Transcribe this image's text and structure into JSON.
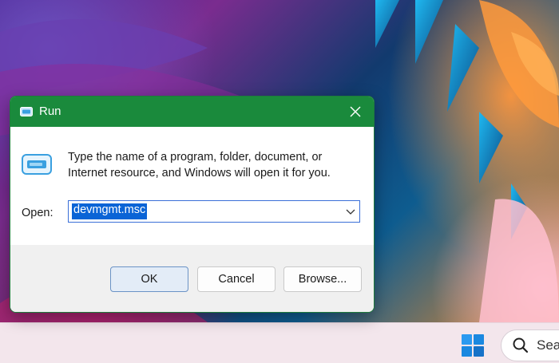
{
  "dialog": {
    "title": "Run",
    "description_line1": "Type the name of a program, folder, document, or",
    "description_line2": "Internet resource, and Windows will open it for you.",
    "open_label": "Open:",
    "open_value": "devmgmt.msc",
    "buttons": {
      "ok": "OK",
      "cancel": "Cancel",
      "browse": "Browse..."
    },
    "titlebar_color": "#1a8a3c",
    "selection_color": "#0a64d6"
  },
  "taskbar": {
    "search_text": "Sea",
    "start_color": "#1a88e0"
  },
  "icons": {
    "title": "run-icon",
    "close": "close-icon",
    "body": "run-icon",
    "dropdown": "chevron-down-icon",
    "start": "windows-logo-icon",
    "search": "search-icon"
  }
}
